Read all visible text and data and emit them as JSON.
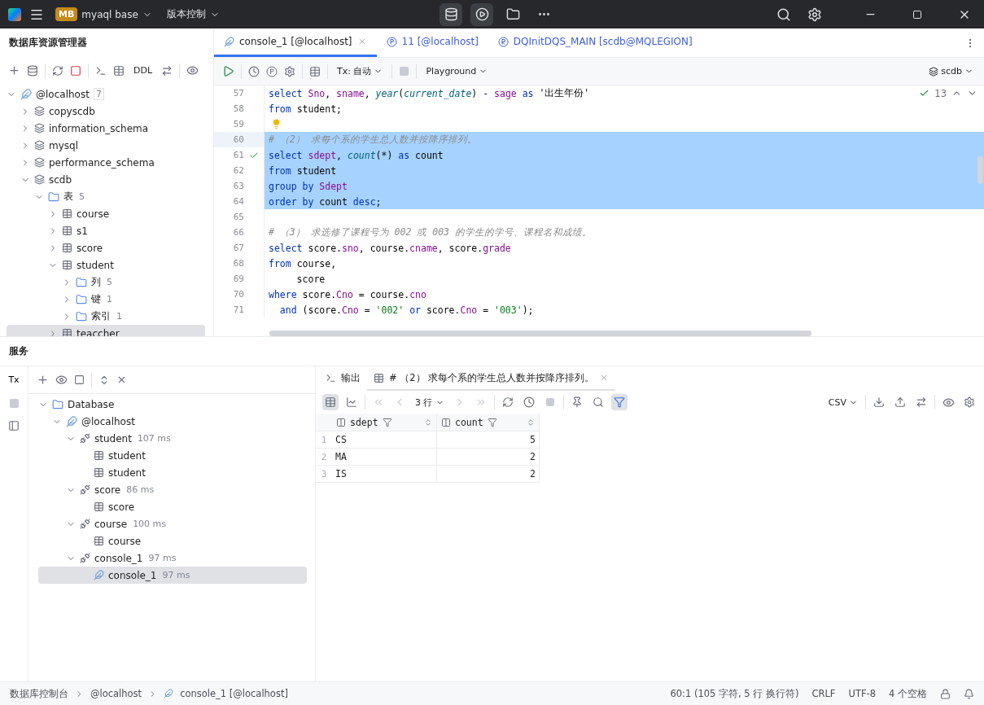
{
  "titlebar": {
    "project_badge": "MB",
    "project": "myaql base",
    "vcs": "版本控制"
  },
  "explorer": {
    "title": "数据库资源管理器",
    "ddl": "DDL",
    "tree": [
      {
        "label": "@localhost",
        "count": "7",
        "kind": "host",
        "expanded": true,
        "selected": false,
        "children": [
          {
            "label": "copyscdb",
            "kind": "schema",
            "expanded": false,
            "selected": false
          },
          {
            "label": "information_schema",
            "kind": "schema",
            "expanded": false,
            "selected": false
          },
          {
            "label": "mysql",
            "kind": "schema",
            "expanded": false,
            "selected": false
          },
          {
            "label": "performance_schema",
            "kind": "schema",
            "expanded": false,
            "selected": false
          },
          {
            "label": "scdb",
            "kind": "schema",
            "expanded": true,
            "selected": false,
            "children": [
              {
                "label": "表",
                "count": "5",
                "kind": "folder",
                "expanded": true,
                "selected": false,
                "children": [
                  {
                    "label": "course",
                    "kind": "table",
                    "expanded": false,
                    "selected": false
                  },
                  {
                    "label": "s1",
                    "kind": "table",
                    "expanded": false,
                    "selected": false
                  },
                  {
                    "label": "score",
                    "kind": "table",
                    "expanded": false,
                    "selected": false
                  },
                  {
                    "label": "student",
                    "kind": "table",
                    "expanded": true,
                    "selected": false,
                    "children": [
                      {
                        "label": "列",
                        "count": "5",
                        "kind": "folder",
                        "expanded": false,
                        "selected": false
                      },
                      {
                        "label": "键",
                        "count": "1",
                        "kind": "folder",
                        "expanded": false,
                        "selected": false
                      },
                      {
                        "label": "索引",
                        "count": "1",
                        "kind": "folder",
                        "expanded": false,
                        "selected": false
                      }
                    ]
                  },
                  {
                    "label": "teaccher",
                    "kind": "table",
                    "expanded": false,
                    "selected": true
                  }
                ]
              }
            ]
          }
        ]
      }
    ]
  },
  "editor": {
    "tabs": [
      {
        "label": "console_1 [@localhost]",
        "kind": "console",
        "selected": true
      },
      {
        "label": "11 [@localhost]",
        "kind": "p",
        "selected": false
      },
      {
        "label": "DQInitDQS_MAIN [scdb@MQLEGION]",
        "kind": "r",
        "selected": false
      }
    ],
    "tx": "Tx: 自动",
    "mode": "Playground",
    "schema": "scdb",
    "inspections": "13",
    "lines": [
      {
        "number": "57",
        "selected": false,
        "tokens": [
          {
            "t": "select ",
            "kind": "keyword"
          },
          {
            "t": "Sno",
            "kind": "field"
          },
          {
            "t": ", ",
            "kind": "plain"
          },
          {
            "t": "sname",
            "kind": "field"
          },
          {
            "t": ", ",
            "kind": "plain"
          },
          {
            "t": "year",
            "kind": "function"
          },
          {
            "t": "(",
            "kind": "plain"
          },
          {
            "t": "current_date",
            "kind": "function"
          },
          {
            "t": ") - ",
            "kind": "plain"
          },
          {
            "t": "sage ",
            "kind": "field"
          },
          {
            "t": "as ",
            "kind": "keyword"
          },
          {
            "t": "'出生年份'",
            "kind": "plain"
          }
        ]
      },
      {
        "number": "58",
        "selected": false,
        "tokens": [
          {
            "t": "from ",
            "kind": "keyword"
          },
          {
            "t": "student;",
            "kind": "plain"
          }
        ]
      },
      {
        "number": "59",
        "selected": false,
        "hint": true
      },
      {
        "number": "60",
        "selected": true,
        "current": true,
        "tokens": [
          {
            "t": "# （2） 求每个系的学生总人数并按降序排列。",
            "kind": "comment"
          }
        ]
      },
      {
        "number": "61",
        "selected": true,
        "passed": true,
        "tokens": [
          {
            "t": "select ",
            "kind": "keyword"
          },
          {
            "t": "sdept",
            "kind": "field"
          },
          {
            "t": ", ",
            "kind": "plain"
          },
          {
            "t": "count",
            "kind": "function"
          },
          {
            "t": "(*) ",
            "kind": "plain"
          },
          {
            "t": "as ",
            "kind": "keyword"
          },
          {
            "t": "count",
            "kind": "plain"
          }
        ]
      },
      {
        "number": "62",
        "selected": true,
        "tokens": [
          {
            "t": "from ",
            "kind": "keyword"
          },
          {
            "t": "student",
            "kind": "plain"
          }
        ]
      },
      {
        "number": "63",
        "selected": true,
        "tokens": [
          {
            "t": "group by ",
            "kind": "keyword"
          },
          {
            "t": "Sdept",
            "kind": "field"
          }
        ]
      },
      {
        "number": "64",
        "selected": true,
        "tokens": [
          {
            "t": "order by ",
            "kind": "keyword"
          },
          {
            "t": "count ",
            "kind": "plain"
          },
          {
            "t": "desc",
            "kind": "keyword"
          },
          {
            "t": ";",
            "kind": "plain"
          }
        ]
      },
      {
        "number": "65",
        "selected": false
      },
      {
        "number": "66",
        "selected": false,
        "tokens": [
          {
            "t": "# （3） 求选修了课程号为 002 或 003 的学生的学号、课程名和成绩。",
            "kind": "comment"
          }
        ]
      },
      {
        "number": "67",
        "selected": false,
        "tokens": [
          {
            "t": "select ",
            "kind": "keyword"
          },
          {
            "t": "score.",
            "kind": "plain"
          },
          {
            "t": "sno",
            "kind": "field"
          },
          {
            "t": ", course.",
            "kind": "plain"
          },
          {
            "t": "cname",
            "kind": "field"
          },
          {
            "t": ", score.",
            "kind": "plain"
          },
          {
            "t": "grade",
            "kind": "field"
          }
        ]
      },
      {
        "number": "68",
        "selected": false,
        "tokens": [
          {
            "t": "from ",
            "kind": "keyword"
          },
          {
            "t": "course,",
            "kind": "plain"
          }
        ]
      },
      {
        "number": "69",
        "selected": false,
        "tokens": [
          {
            "t": "     score",
            "kind": "plain"
          }
        ]
      },
      {
        "number": "70",
        "selected": false,
        "tokens": [
          {
            "t": "where ",
            "kind": "keyword"
          },
          {
            "t": "score.",
            "kind": "plain"
          },
          {
            "t": "Cno",
            "kind": "field"
          },
          {
            "t": " = course.",
            "kind": "plain"
          },
          {
            "t": "cno",
            "kind": "field"
          }
        ]
      },
      {
        "number": "71",
        "selected": false,
        "tokens": [
          {
            "t": "  and ",
            "kind": "keyword"
          },
          {
            "t": "(score.",
            "kind": "plain"
          },
          {
            "t": "Cno",
            "kind": "field"
          },
          {
            "t": " = ",
            "kind": "plain"
          },
          {
            "t": "'002' ",
            "kind": "string"
          },
          {
            "t": "or ",
            "kind": "keyword"
          },
          {
            "t": "score.",
            "kind": "plain"
          },
          {
            "t": "Cno",
            "kind": "field"
          },
          {
            "t": " = ",
            "kind": "plain"
          },
          {
            "t": "'003'",
            "kind": "string"
          },
          {
            "t": ");",
            "kind": "plain"
          }
        ]
      }
    ]
  },
  "services": {
    "title": "服务",
    "tx": "Tx",
    "tree": [
      {
        "label": "Database",
        "kind": "folder",
        "expanded": true,
        "selected": false,
        "children": [
          {
            "label": "@localhost",
            "kind": "host",
            "expanded": true,
            "selected": false,
            "children": [
              {
                "label": "student",
                "time": "107 ms",
                "kind": "session",
                "expanded": true,
                "selected": false,
                "children": [
                  {
                    "label": "student",
                    "kind": "table",
                    "selected": false
                  },
                  {
                    "label": "student",
                    "kind": "table",
                    "selected": false
                  }
                ]
              },
              {
                "label": "score",
                "time": "86 ms",
                "kind": "session",
                "expanded": true,
                "selected": false,
                "children": [
                  {
                    "label": "score",
                    "kind": "table",
                    "selected": false
                  }
                ]
              },
              {
                "label": "course",
                "time": "100 ms",
                "kind": "session",
                "expanded": true,
                "selected": false,
                "children": [
                  {
                    "label": "course",
                    "kind": "table",
                    "selected": false
                  }
                ]
              },
              {
                "label": "console_1",
                "time": "97 ms",
                "kind": "session",
                "expanded": true,
                "selected": false,
                "children": [
                  {
                    "label": "console_1",
                    "time": "97 ms",
                    "kind": "console",
                    "selected": true
                  }
                ]
              }
            ]
          }
        ]
      }
    ]
  },
  "results": {
    "tabs": [
      {
        "label": "输出",
        "kind": "output",
        "selected": false
      },
      {
        "label": "# （2） 求每个系的学生总人数并按降序排列。",
        "kind": "grid",
        "selected": true
      }
    ],
    "rows_label": "3 行",
    "format": "CSV",
    "columns": [
      {
        "name": "sdept",
        "kind": "text"
      },
      {
        "name": "count",
        "kind": "number"
      }
    ],
    "rows": [
      {
        "number": "1",
        "cells": [
          "CS",
          "5"
        ]
      },
      {
        "number": "2",
        "cells": [
          "MA",
          "2"
        ]
      },
      {
        "number": "3",
        "cells": [
          "IS",
          "2"
        ]
      }
    ]
  },
  "status_bar": {
    "breadcrumbs": [
      "数据库控制台",
      "@localhost",
      "console_1 [@localhost]"
    ],
    "items": [
      "60:1 (105 字符, 5 行 换行符)",
      "CRLF",
      "UTF-8",
      "4 个空格"
    ]
  }
}
